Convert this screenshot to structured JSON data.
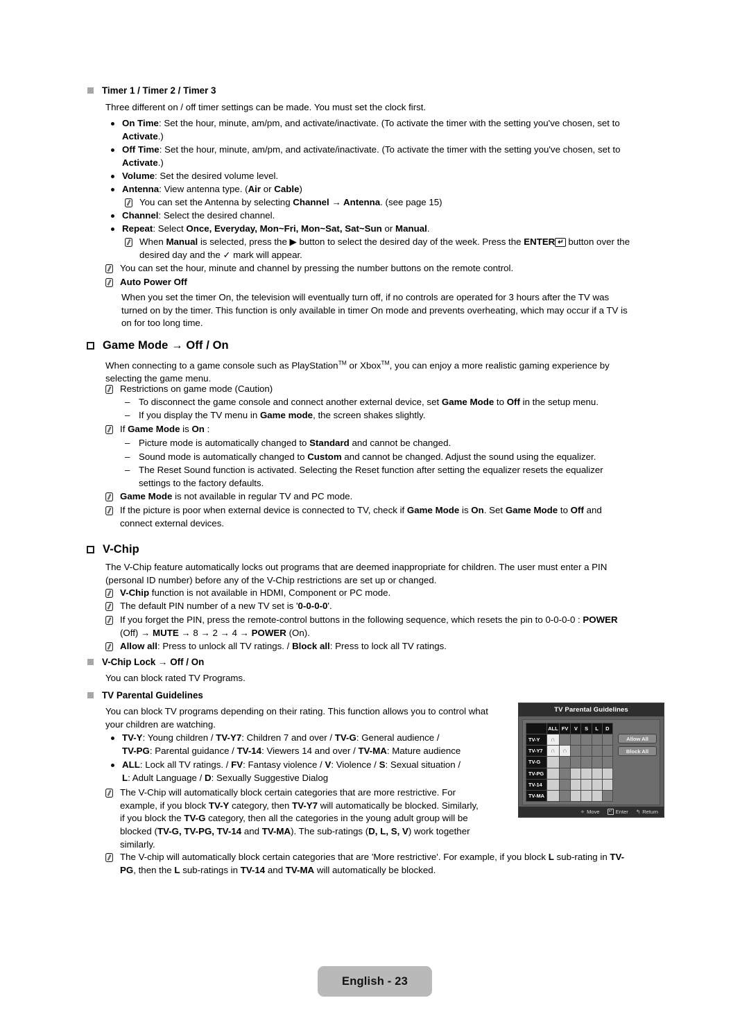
{
  "document": {
    "footer_label": "English - 23"
  },
  "timer_section": {
    "heading": "Timer 1 / Timer 2 / Timer 3",
    "intro": "Three different on / off timer settings can be made. You must set the clock first.",
    "bullets": [
      {
        "term": "On Time",
        "rest": ": Set the hour, minute, am/pm, and activate/inactivate. (To activate the timer with the setting you've chosen, set to ",
        "term2": "Activate",
        "tail": ".)"
      },
      {
        "term": "Off Time",
        "rest": ": Set the hour, minute, am/pm, and activate/inactivate. (To activate the timer with the setting you've chosen, set to ",
        "term2": "Activate",
        "tail": ".)"
      },
      {
        "term": "Volume",
        "rest": ": Set the desired volume level."
      },
      {
        "term": "Antenna",
        "rest": ": View antenna type. (",
        "term2": "Air",
        "mid": " or ",
        "term3": "Cable",
        "tail": ")"
      },
      {
        "term": "Channel",
        "rest": ": Select the desired channel."
      },
      {
        "term": "Repeat",
        "rest": ": Select ",
        "term2": "Once, Everyday, Mon~Fri, Mon~Sat, Sat~Sun",
        "mid": " or ",
        "term3": "Manual",
        "tail": "."
      }
    ],
    "note_antenna": {
      "pre": "You can set the Antenna by selecting ",
      "b1": "Channel",
      "arrow": " → ",
      "b2": "Antenna",
      "post": ". (see page 15)"
    },
    "note_manual": {
      "pre": "When ",
      "b1": "Manual",
      "mid1": " is selected, press the ▶ button to select the desired day of the week. Press the ",
      "b2": "ENTER",
      "key": "↵",
      "mid2": " button over the",
      "line2_pre": "desired day and the ",
      "check": "✓",
      "line2_post": " mark will appear."
    },
    "note_numbers": "You can set the hour, minute and channel by pressing the number buttons on the remote control.",
    "note_autopower_title": "Auto Power Off",
    "autopower_body": [
      "When you set the timer On, the television will eventually turn off, if no controls are operated for 3 hours after the TV was",
      "turned on by the timer. This function is only available in timer On mode and prevents overheating, which may occur if a TV is",
      "on for too long time."
    ]
  },
  "game_mode_section": {
    "heading": "Game Mode → Off / On",
    "intro_line1": "When connecting to a game console such as PlayStation",
    "intro_tm1": "TM",
    "intro_mid": " or Xbox",
    "intro_tm2": "TM",
    "intro_line1b": ", you can enjoy a more realistic gaming experience by",
    "intro_line2": "selecting the game menu.",
    "note_restrictions": "Restrictions on game mode (Caution)",
    "dash_disconnect": {
      "pre": "To disconnect the game console and connect another external device, set ",
      "b1": "Game Mode",
      "mid": " to ",
      "b2": "Off",
      "post": " in the setup menu."
    },
    "dash_menu": {
      "pre": "If you display the TV menu in ",
      "b1": "Game mode",
      "post": ", the screen shakes slightly."
    },
    "note_if_on": {
      "pre": "If ",
      "b1": "Game Mode",
      "mid": " is ",
      "b2": "On",
      "post": " :"
    },
    "dash_picture": {
      "pre": "Picture mode is automatically changed to ",
      "b1": "Standard",
      "post": " and cannot be changed."
    },
    "dash_sound": {
      "pre": "Sound mode is automatically changed to ",
      "b1": "Custom",
      "post": " and cannot be changed. Adjust the sound using the equalizer."
    },
    "dash_reset_l1": "The Reset Sound function is activated. Selecting the Reset function after setting the equalizer resets the equalizer",
    "dash_reset_l2": "settings to the factory defaults.",
    "note_not_available": {
      "b1": "Game Mode",
      "post": " is not available in regular TV and PC mode."
    },
    "note_poor_picture": {
      "pre": "If the picture is poor when external device is connected to TV, check if ",
      "b1": "Game Mode",
      "mid1": " is ",
      "b2": "On",
      "mid2": ". Set ",
      "b3": "Game Mode",
      "mid3": " to ",
      "b4": "Off",
      "post": " and",
      "line2": "connect external devices."
    }
  },
  "vchip_section": {
    "heading": "V-Chip",
    "intro_l1": "The V-Chip feature automatically locks out programs that are deemed inappropriate for children. The user must enter a PIN",
    "intro_l2": "(personal ID number) before any of the V-Chip restrictions are set up or changed.",
    "note_hdmi": {
      "b1": "V-Chip",
      "post": " function is not available in HDMI, Component or PC mode."
    },
    "note_default_pin": {
      "pre": "The default PIN number of a new TV set is '",
      "b1": "0-0-0-0",
      "post": "'."
    },
    "note_forgot_pin": {
      "pre": "If you forget the PIN, press the remote-control buttons in the following sequence, which resets the pin to 0-0-0-0 : ",
      "b1": "POWER",
      "l2_pre": "(Off) → ",
      "b2": "MUTE",
      "l2_mid": " → 8 → 2 → 4 → ",
      "b3": "POWER",
      "l2_post": " (On)."
    },
    "note_allow_block": {
      "b1": "Allow all",
      "mid1": ": Press to unlock all TV ratings. / ",
      "b2": "Block all",
      "post": ": Press to lock all TV ratings."
    },
    "lock_heading": "V-Chip Lock → Off / On",
    "lock_body": "You can block rated TV Programs.",
    "guidelines_heading": "TV Parental Guidelines",
    "guidelines_body_l1": "You can block TV programs depending on their rating. This function allows you to control what",
    "guidelines_body_l2": "your children are watching.",
    "ratings_bullet": {
      "b1": "TV-Y",
      "t1": ": Young children / ",
      "b2": "TV-Y7",
      "t2": ": Children 7 and over / ",
      "b3": "TV-G",
      "t3": ": General audience /",
      "b4": "TV-PG",
      "t4": ": Parental guidance / ",
      "b5": "TV-14",
      "t5": ": Viewers 14 and over / ",
      "b6": "TV-MA",
      "t6": ": Mature audience"
    },
    "subratings_bullet": {
      "b1": "ALL",
      "t1": ": Lock all TV ratings. / ",
      "b2": "FV",
      "t2": ": Fantasy violence / ",
      "b3": "V",
      "t3": ": Violence / ",
      "b4": "S",
      "t4": ": Sexual situation /",
      "b5": "L",
      "t5": ": Adult Language / ",
      "b6": "D",
      "t6": ": Sexually Suggestive Dialog"
    },
    "note_more_restrictive": {
      "l1_pre": "The V-Chip will automatically block certain categories that are more restrictive. For",
      "l2_pre": "example, if you block ",
      "l2_b1": "TV-Y",
      "l2_mid": " category, then ",
      "l2_b2": "TV-Y7",
      "l2_post": " will automatically be blocked. Similarly,",
      "l3_pre": "if you block the ",
      "l3_b1": "TV-G",
      "l3_post": " category, then all the categories in the young adult group will be",
      "l4_pre": "blocked (",
      "l4_b1": "TV-G, TV-PG, TV-14",
      "l4_mid": " and ",
      "l4_b2": "TV-MA",
      "l4_post": "). The sub-ratings (",
      "l4_b3": "D, L, S, V",
      "l4_tail": ") work together",
      "l5": "similarly."
    },
    "note_more_restrictive2": {
      "l1_pre": "The V-chip will automatically block certain categories that are 'More restrictive'. For example, if you block ",
      "l1_b1": "L",
      "l1_mid": " sub-rating in ",
      "l1_b2": "TV-",
      "l2_b1": "PG",
      "l2_mid": ", then the ",
      "l2_b2": "L",
      "l2_mid2": " sub-ratings in ",
      "l2_b3": "TV-14",
      "l2_mid3": " and ",
      "l2_b4": "TV-MA",
      "l2_post": " will automatically be blocked."
    }
  },
  "osd": {
    "title": "TV Parental Guidelines",
    "columns": [
      "ALL",
      "FV",
      "V",
      "S",
      "L",
      "D"
    ],
    "rows": [
      {
        "label": "TV-Y",
        "cells": [
          "white-lock",
          "dark",
          "dark",
          "dark",
          "dark",
          "dark"
        ]
      },
      {
        "label": "TV-Y7",
        "cells": [
          "white-lock",
          "white-lock",
          "dark",
          "dark",
          "dark",
          "dark"
        ]
      },
      {
        "label": "TV-G",
        "cells": [
          "light",
          "dark",
          "dark",
          "dark",
          "dark",
          "dark"
        ]
      },
      {
        "label": "TV-PG",
        "cells": [
          "light",
          "dark",
          "light",
          "light",
          "light",
          "light"
        ]
      },
      {
        "label": "TV-14",
        "cells": [
          "light",
          "dark",
          "light",
          "light",
          "light",
          "light"
        ]
      },
      {
        "label": "TV-MA",
        "cells": [
          "light",
          "dark",
          "light",
          "light",
          "light",
          "dark"
        ]
      }
    ],
    "buttons": {
      "allow_all": "Allow All",
      "block_all": "Block All"
    },
    "footer": {
      "move": "Move",
      "enter": "Enter",
      "return": "Return"
    },
    "lock_glyph": "∩"
  }
}
